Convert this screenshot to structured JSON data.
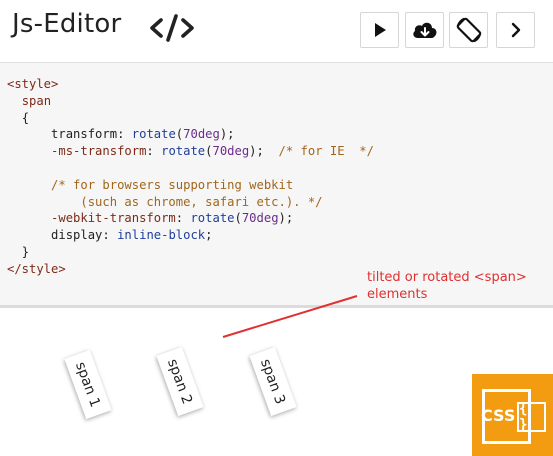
{
  "header": {
    "title": "Js-Editor",
    "icons": [
      "code-icon",
      "play-icon",
      "cloud-download-icon",
      "rotate-device-icon",
      "chevron-right-icon"
    ]
  },
  "editor": {
    "code": {
      "l1": "<style>",
      "l2_sel": "span",
      "l3": "{",
      "l4_prop": "transform",
      "l4_fn": "rotate",
      "l4_num": "70deg",
      "l5_prop": "-ms-transform",
      "l5_fn": "rotate",
      "l5_num": "70deg",
      "l5_cmt": "/* for IE  */",
      "l6_cmt": "/* for browsers supporting webkit",
      "l7_cmt": "(such as chrome, safari etc.). */",
      "l8_prop": "-webkit-transform",
      "l8_fn": "rotate",
      "l8_num": "70deg",
      "l9_prop": "display",
      "l9_val": "inline-block",
      "l10": "}",
      "l11": "</style>"
    }
  },
  "annotation": {
    "line1": "tilted or rotated <span>",
    "line2": "elements"
  },
  "preview": {
    "spans": [
      "span 1",
      "span 2",
      "span 3"
    ]
  },
  "logo": {
    "text": "CSS",
    "brace": "{ }"
  },
  "colors": {
    "annotation": "#e03030",
    "logo": "#f39c12",
    "editor_bg": "#f6f6f6"
  }
}
